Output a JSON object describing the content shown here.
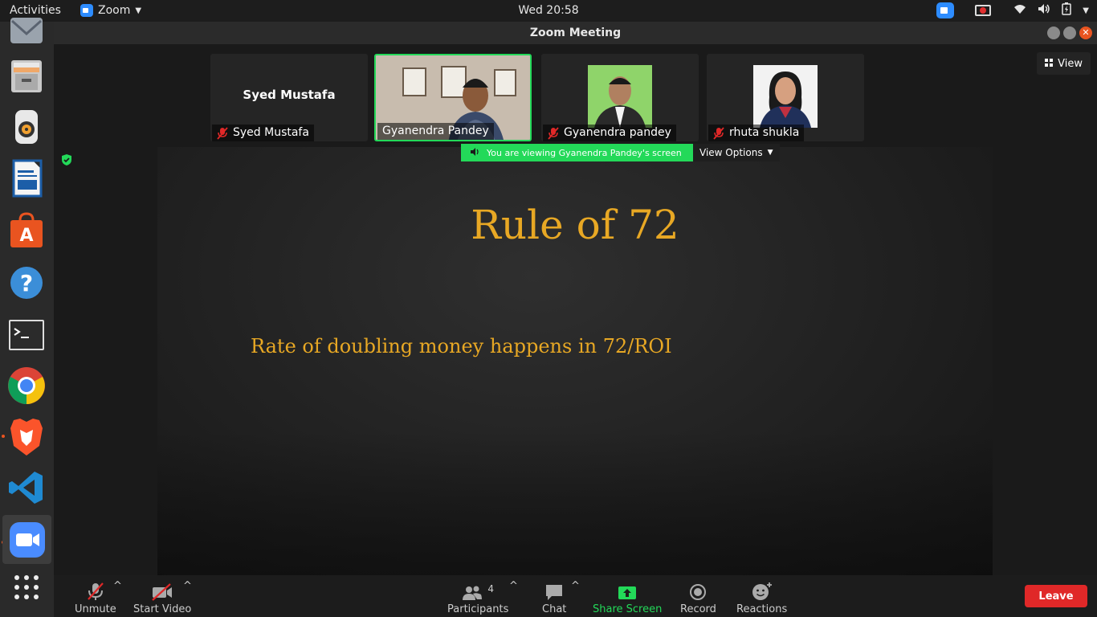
{
  "topbar": {
    "activities": "Activities",
    "app_name": "Zoom",
    "clock": "Wed 20:58"
  },
  "window": {
    "title": "Zoom Meeting"
  },
  "view_button": {
    "label": "View"
  },
  "participants_strip": [
    {
      "name": "Syed Mustafa",
      "tile_label": "Syed Mustafa",
      "muted": true,
      "video": false
    },
    {
      "name": "Gyanendra Pandey",
      "muted": false,
      "video": true,
      "speaking": true
    },
    {
      "name": "Gyanendra pandey",
      "muted": true,
      "video": true
    },
    {
      "name": "rhuta shukla",
      "muted": true,
      "video": true
    }
  ],
  "share": {
    "banner": "You are viewing Gyanendra Pandey's screen",
    "view_options": "View Options"
  },
  "slide": {
    "title": "Rule of 72",
    "body": "Rate of doubling money happens in 72/ROI"
  },
  "toolbar": {
    "unmute": "Unmute",
    "start_video": "Start Video",
    "participants": "Participants",
    "participants_count": "4",
    "chat": "Chat",
    "share_screen": "Share Screen",
    "record": "Record",
    "reactions": "Reactions",
    "leave": "Leave"
  },
  "colors": {
    "accent_green": "#23d959",
    "leave_red": "#e02828",
    "slide_gold": "#e8a824",
    "zoom_blue": "#2d8cff"
  }
}
